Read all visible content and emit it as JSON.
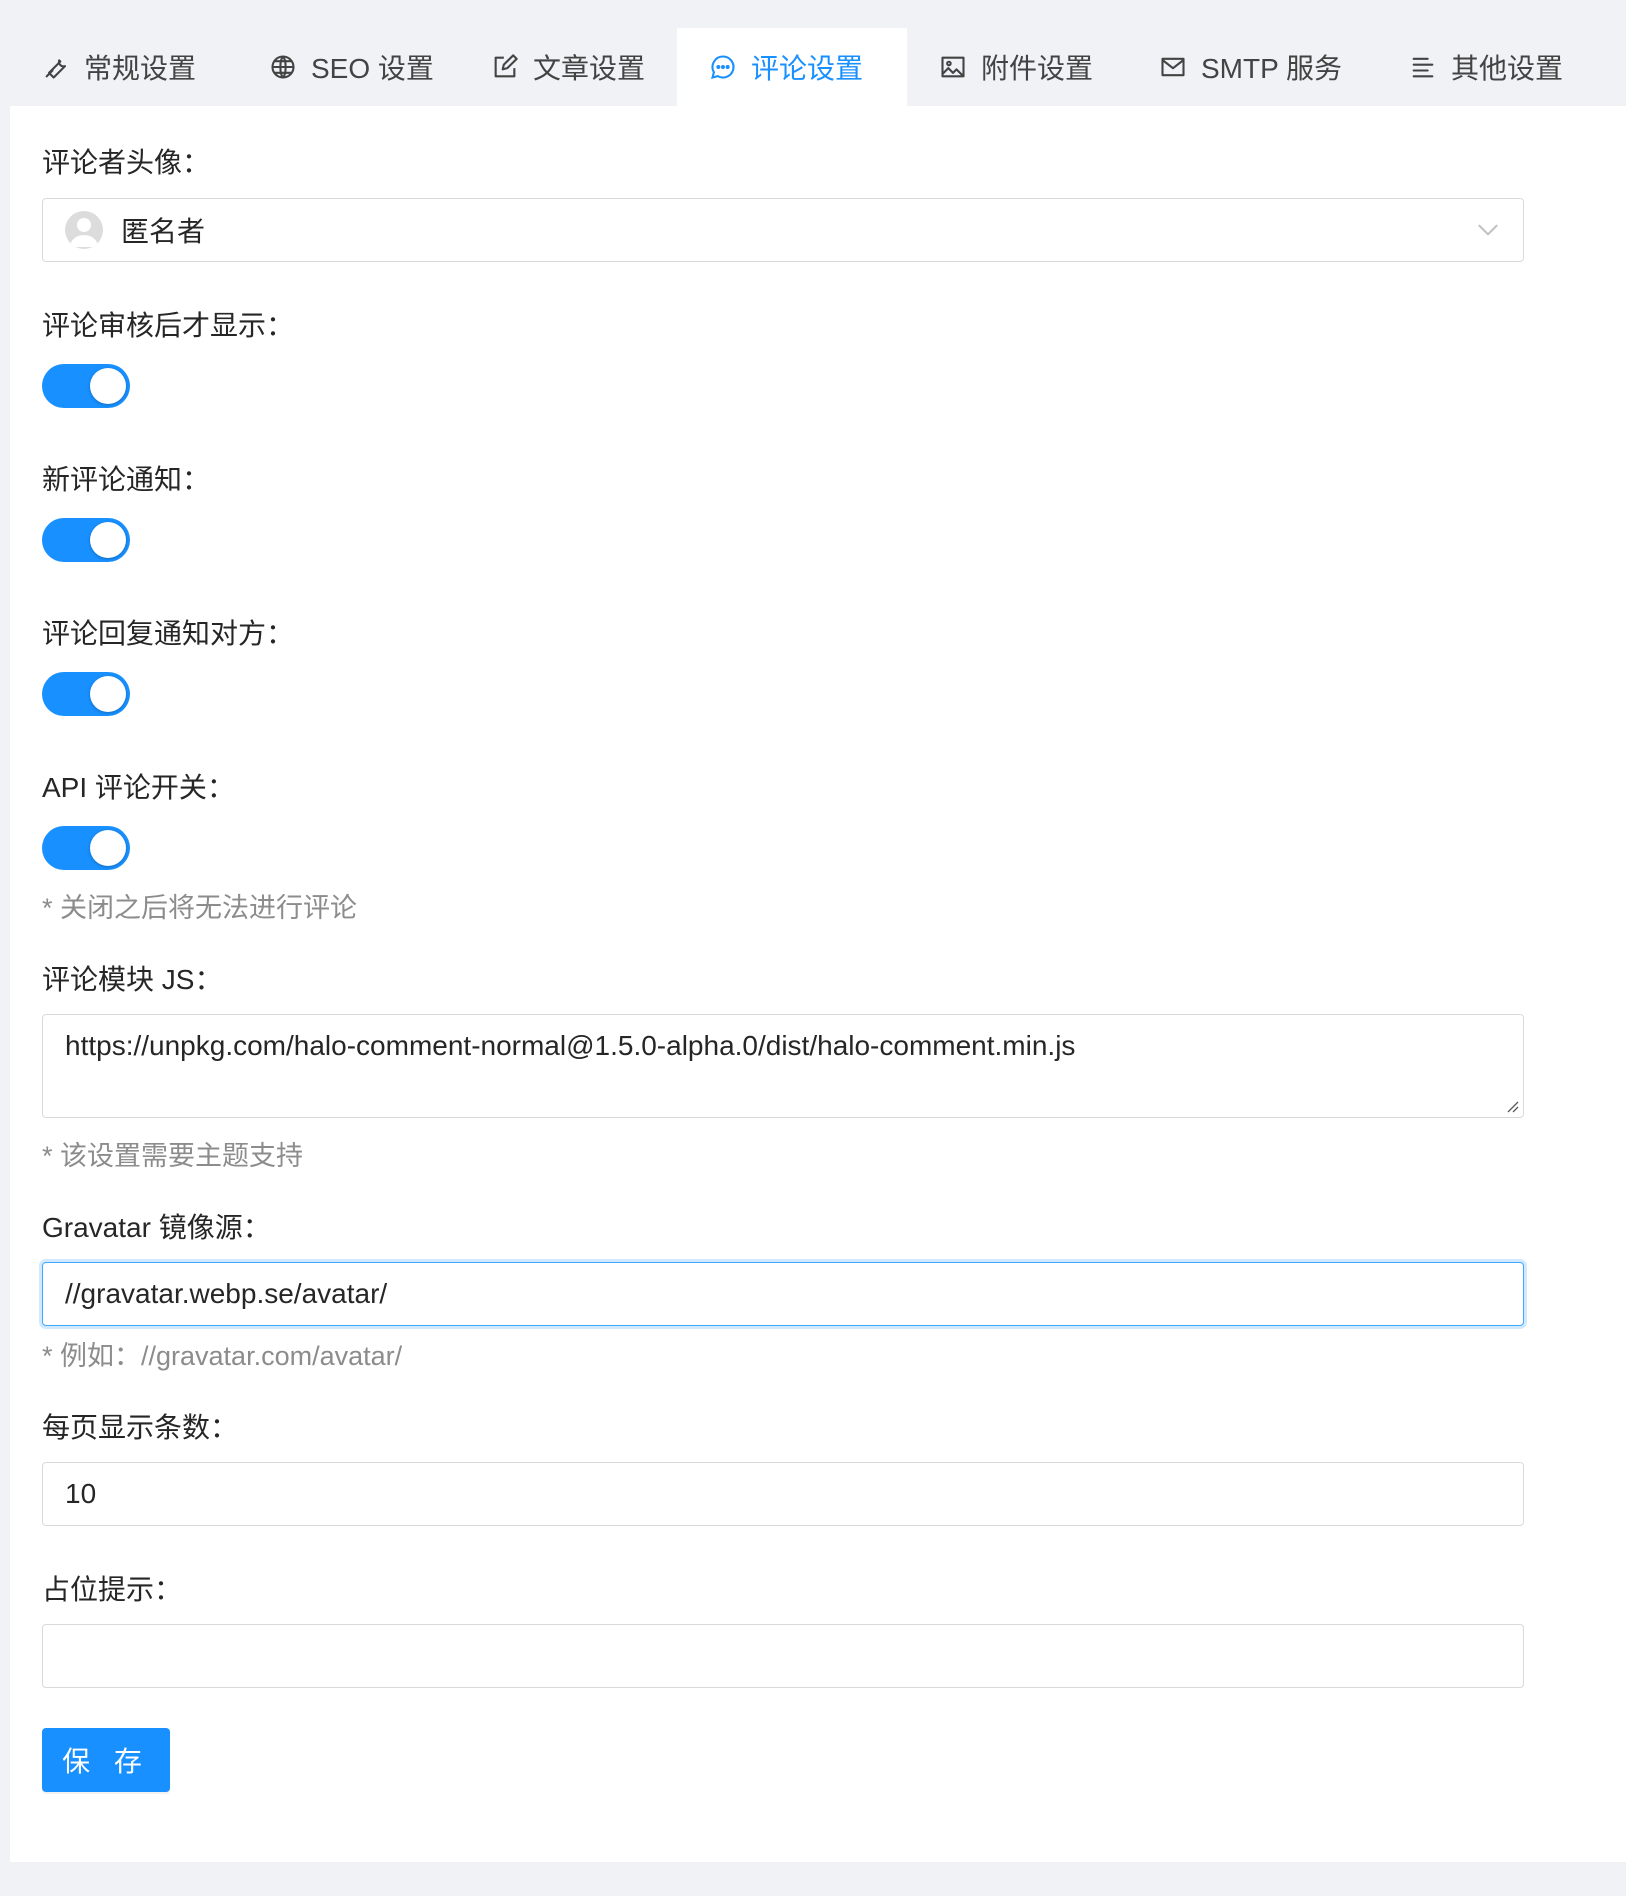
{
  "tabs": [
    {
      "label": "常规设置",
      "icon": "wrench-icon"
    },
    {
      "label": "SEO 设置",
      "icon": "globe-icon"
    },
    {
      "label": "文章设置",
      "icon": "edit-icon"
    },
    {
      "label": "评论设置",
      "icon": "message-icon",
      "active": true
    },
    {
      "label": "附件设置",
      "icon": "image-icon"
    },
    {
      "label": "SMTP 服务",
      "icon": "mail-icon"
    },
    {
      "label": "其他设置",
      "icon": "align-left-icon"
    }
  ],
  "form": {
    "avatar": {
      "label": "评论者头像：",
      "value": "匿名者"
    },
    "need_check": {
      "label": "评论审核后才显示：",
      "on": true
    },
    "new_notice": {
      "label": "新评论通知：",
      "on": true
    },
    "reply_notice": {
      "label": "评论回复通知对方：",
      "on": true
    },
    "api_enabled": {
      "label": "API 评论开关：",
      "on": true,
      "hint": "* 关闭之后将无法进行评论"
    },
    "internal_js": {
      "label": "评论模块 JS：",
      "value": "https://unpkg.com/halo-comment-normal@1.5.0-alpha.0/dist/halo-comment.min.js",
      "hint": "* 该设置需要主题支持"
    },
    "gravatar": {
      "label": "Gravatar 镜像源：",
      "value": "//gravatar.webp.se/avatar/",
      "hint": "* 例如：//gravatar.com/avatar/"
    },
    "page_size": {
      "label": "每页显示条数：",
      "value": "10"
    },
    "placeholder": {
      "label": "占位提示：",
      "value": ""
    },
    "save_label": "保 存"
  },
  "colors": {
    "accent": "#1890ff",
    "text": "#262626",
    "hint": "#8c8c8c",
    "border": "#d9d9d9"
  }
}
